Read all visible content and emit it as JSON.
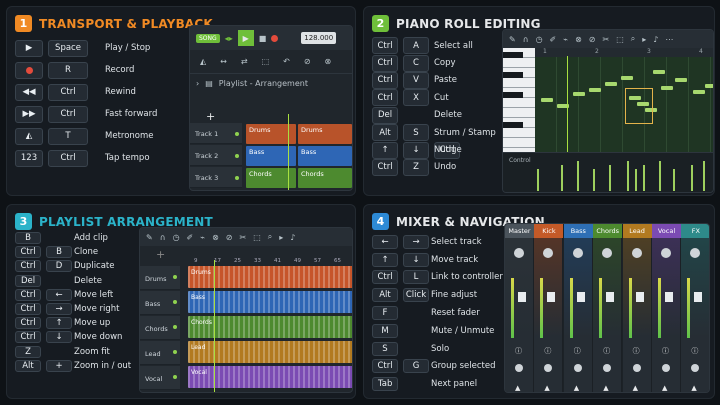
{
  "colors": {
    "orange": "#f08a24",
    "green": "#6fbf3a",
    "teal": "#2bb3c9",
    "blue": "#2d8ad6"
  },
  "p1": {
    "num": "1",
    "title": "TRANSPORT & PLAYBACK",
    "rows": [
      {
        "k1": "▶",
        "label": "Play / Stop",
        "k2": "Space"
      },
      {
        "k1": "●",
        "label": "Record",
        "k2": "R"
      },
      {
        "k1": "◀◀",
        "label": "Rewind",
        "k2": "Ctrl"
      },
      {
        "k1": "▶▶",
        "label": "Fast forward",
        "k2": "Ctrl"
      },
      {
        "k1": "metronome-icon",
        "label": "Metronome",
        "k2": "T"
      },
      {
        "k1": "123",
        "label": "Tap tempo",
        "k2": "Ctrl"
      }
    ],
    "app": {
      "song": "SONG",
      "tempo": "128.000",
      "playlist": "Playlist - Arrangement",
      "tracks": [
        "Track 1",
        "Track 2",
        "Track 3"
      ],
      "clips": [
        "Drums",
        "Drums",
        "Bass",
        "Bass",
        "Chords",
        "Chords"
      ]
    }
  },
  "p2": {
    "num": "2",
    "title": "PIANO ROLL EDITING",
    "rows": [
      {
        "a": "Ctrl",
        "b": "A",
        "label": "Select all"
      },
      {
        "a": "Ctrl",
        "b": "C",
        "label": "Copy"
      },
      {
        "a": "Ctrl",
        "b": "V",
        "label": "Paste"
      },
      {
        "a": "Ctrl",
        "b": "X",
        "label": "Cut"
      },
      {
        "a": "Del",
        "b": "",
        "label": "Delete"
      },
      {
        "a": "Alt",
        "b": "S",
        "label": "Strum / Stamp"
      },
      {
        "a": "↑",
        "b": "↓",
        "c": "Ctrl",
        "label": "Nudge"
      },
      {
        "a": "Ctrl",
        "b": "Z",
        "label": "Undo"
      }
    ],
    "app": {
      "control": "Control",
      "ruler": [
        "1",
        "2",
        "3",
        "4"
      ]
    }
  },
  "p3": {
    "num": "3",
    "title": "PLAYLIST ARRANGEMENT",
    "rows": [
      {
        "a": "B",
        "b": "",
        "label": "Add clip"
      },
      {
        "a": "Ctrl",
        "b": "B",
        "label": "Clone"
      },
      {
        "a": "Ctrl",
        "b": "D",
        "label": "Duplicate"
      },
      {
        "a": "Del",
        "b": "",
        "label": "Delete"
      },
      {
        "a": "Ctrl",
        "b": "←",
        "label": "Move left"
      },
      {
        "a": "Ctrl",
        "b": "→",
        "label": "Move right"
      },
      {
        "a": "Ctrl",
        "b": "↑",
        "label": "Move up"
      },
      {
        "a": "Ctrl",
        "b": "↓",
        "label": "Move down"
      },
      {
        "a": "Z",
        "b": "",
        "label": "Zoom fit"
      },
      {
        "a": "Alt",
        "b": "+",
        "label": "Zoom in / out"
      }
    ],
    "app": {
      "tracks": [
        "Drums",
        "Bass",
        "Chords",
        "Lead",
        "Vocal"
      ],
      "ruler": [
        "9",
        "17",
        "25",
        "33",
        "41",
        "49",
        "57",
        "65",
        "73"
      ]
    }
  },
  "p4": {
    "num": "4",
    "title": "MIXER & NAVIGATION",
    "rows": [
      {
        "a": "←",
        "b": "→",
        "label": "Select track"
      },
      {
        "a": "↑",
        "b": "↓",
        "label": "Move track"
      },
      {
        "a": "Ctrl",
        "b": "L",
        "label": "Link to controller"
      },
      {
        "a": "Alt",
        "b": "Click",
        "label": "Fine adjust"
      },
      {
        "a": "F",
        "b": "",
        "label": "Reset fader"
      },
      {
        "a": "M",
        "b": "",
        "label": "Mute / Unmute"
      },
      {
        "a": "S",
        "b": "",
        "label": "Solo"
      },
      {
        "a": "Ctrl",
        "b": "G",
        "label": "Group selected"
      },
      {
        "a": "Tab",
        "b": "",
        "label": "Next panel"
      }
    ],
    "app": {
      "channels": [
        "Master",
        "Kick",
        "Bass",
        "Chords",
        "Lead",
        "Vocal",
        "FX"
      ]
    }
  }
}
